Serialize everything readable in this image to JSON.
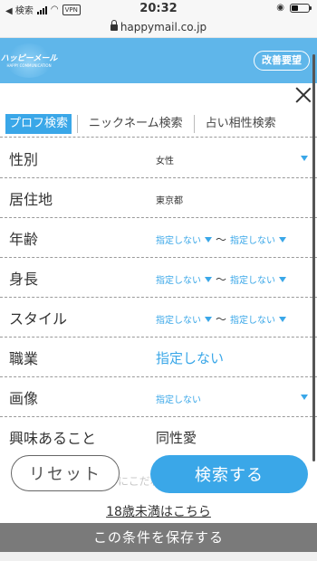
{
  "status": {
    "back_app": "◀ 検索",
    "vpn": "VPN",
    "time": "20:32"
  },
  "url": {
    "host": "happymail.co.jp"
  },
  "header": {
    "logo_main": "ハッピーメール",
    "logo_sub": "HAPPY COMMUNICATION",
    "improve_label": "改善要望"
  },
  "tabs": [
    {
      "label": "プロフ検索",
      "active": true
    },
    {
      "label": "ニックネーム検索"
    },
    {
      "label": "占い相性検索"
    }
  ],
  "fields": {
    "gender": {
      "label": "性別",
      "value": "女性"
    },
    "residence": {
      "label": "居住地",
      "value": "東京都"
    },
    "age": {
      "label": "年齢",
      "from": "指定しない",
      "to": "指定しない"
    },
    "height": {
      "label": "身長",
      "from": "指定しない",
      "to": "指定しない"
    },
    "style": {
      "label": "スタイル",
      "from": "指定しない",
      "to": "指定しない"
    },
    "job": {
      "label": "職業",
      "value": "指定しない"
    },
    "image": {
      "label": "画像",
      "value": "指定しない"
    },
    "interest": {
      "label": "興味あること",
      "value": "同性愛"
    }
  },
  "range_sep": "〜",
  "actions": {
    "reset_label": "リセット",
    "search_label": "検索する",
    "ghost_label": "さらにこだわる",
    "under18_label": "18歳未満はこちら",
    "save_label": "この条件を保存する"
  }
}
